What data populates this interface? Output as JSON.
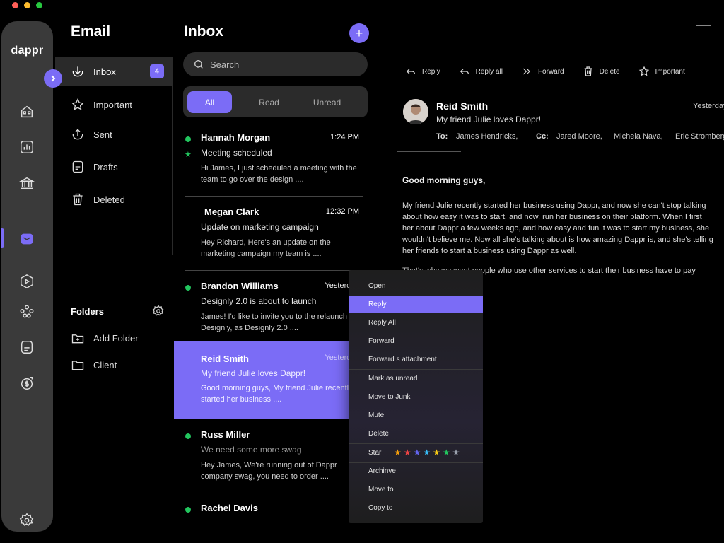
{
  "rail": {
    "logo": "dappr",
    "icons": [
      "home-icon",
      "chart-icon",
      "bank-icon",
      "mail-icon",
      "play-icon",
      "users-icon",
      "document-icon",
      "dollar-icon",
      "settings-icon"
    ],
    "active": "mail-icon",
    "accent": "#7b6cf6"
  },
  "nav": {
    "title": "Email",
    "items": [
      {
        "label": "Inbox",
        "badge": "4",
        "icon": "inbox-icon"
      },
      {
        "label": "Important",
        "icon": "star-icon"
      },
      {
        "label": "Sent",
        "icon": "sent-icon"
      },
      {
        "label": "Drafts",
        "icon": "drafts-icon"
      },
      {
        "label": "Deleted",
        "icon": "trash-icon"
      }
    ],
    "folders_title": "Folders",
    "folders": [
      {
        "label": "Add Folder",
        "icon": "add-folder-icon"
      },
      {
        "label": "Client",
        "icon": "folder-icon"
      }
    ]
  },
  "list": {
    "title": "Inbox",
    "compose_label": "+",
    "search_placeholder": "Search",
    "filters": [
      "All",
      "Read",
      "Unread"
    ],
    "active_filter": "All",
    "mails": [
      {
        "sender": "Hannah Morgan",
        "time": "1:24 PM",
        "subject": "Meeting scheduled",
        "preview": "Hi James, I just scheduled a meeting with the team to go over the design ....",
        "unread": true,
        "starred": true
      },
      {
        "sender": "Megan Clark",
        "time": "12:32 PM",
        "subject": "Update on marketing campaign",
        "preview": "Hey Richard, Here's an update on the marketing campaign my team is ....",
        "unread": false
      },
      {
        "sender": "Brandon Williams",
        "time": "Yesterday",
        "subject": "Designly 2.0 is about to launch",
        "preview": "James! I'd like to invite you to the relaunch of Designly, as Designly 2.0 ....",
        "unread": true
      },
      {
        "sender": "Reid Smith",
        "time": "Yesterday",
        "subject": "My friend Julie loves Dappr!",
        "preview": "Good morning guys, My friend Julie recently started her business ....",
        "unread": false,
        "selected": true
      },
      {
        "sender": "Russ Miller",
        "time": "",
        "subject": "We need some more swag",
        "preview": "Hey James, We're running out of Dappr company swag, you need to order ....",
        "unread": true
      },
      {
        "sender": "Rachel Davis",
        "time": "",
        "subject": "",
        "preview": "",
        "unread": true
      }
    ]
  },
  "toolbar": {
    "reply": "Reply",
    "reply_all": "Reply all",
    "forward": "Forward",
    "delete": "Delete",
    "important": "Important"
  },
  "reader": {
    "from": "Reid Smith",
    "subject": "My friend Julie loves Dappr!",
    "date": "Yesterday",
    "to_label": "To:",
    "to": "James Hendricks,",
    "cc_label": "Cc:",
    "cc": [
      "Jared Moore,",
      "Michela Nava,",
      "Eric Stromberg"
    ],
    "greeting": "Good morning guys,",
    "body": [
      "My friend Julie recently started her business using Dappr, and now she can't stop talking",
      "about how easy it was to start, and now, run her business on their platform. When I first",
      "her about Dappr a few weeks ago, and how easy and fun it was to start my business, she",
      "wouldn't believe me. Now all she's talking about is how amazing Dappr is, and she's telling",
      "her friends to start a business using Dappr as well."
    ],
    "body2": "That's why we want people who use other services to start their business have to pay"
  },
  "context_menu": {
    "items": [
      "Open",
      "Reply",
      "Reply All",
      "Forward",
      "Forward s attachment",
      "Mark as unread",
      "Move to Junk",
      "Mute",
      "Delete",
      "Star",
      "Archinve",
      "Move to",
      "Copy to"
    ],
    "highlighted": "Reply",
    "star_colors": [
      "#f59e0b",
      "#ef4444",
      "#6366f1",
      "#38bdf8",
      "#facc15",
      "#22c55e",
      "#9ca3af"
    ]
  }
}
